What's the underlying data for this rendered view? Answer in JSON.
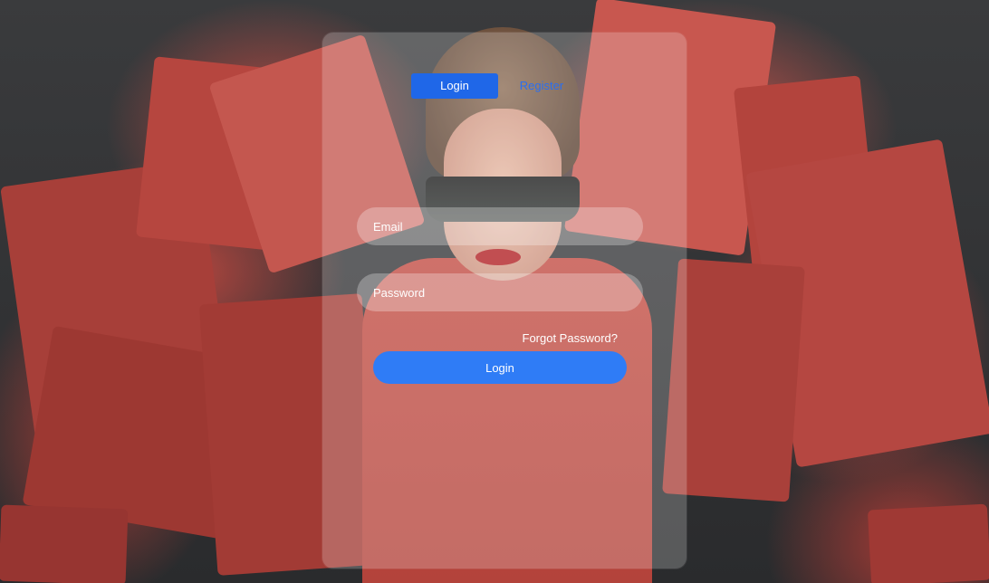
{
  "tabs": {
    "login_label": "Login",
    "register_label": "Register"
  },
  "form": {
    "email_placeholder": "Email",
    "password_placeholder": "Password",
    "forgot_label": "Forgot Password?",
    "submit_label": "Login"
  },
  "colors": {
    "accent": "#1f67e8",
    "button": "#2f7cf6",
    "background": "#2b2b2d",
    "bags": "#b8463f"
  }
}
